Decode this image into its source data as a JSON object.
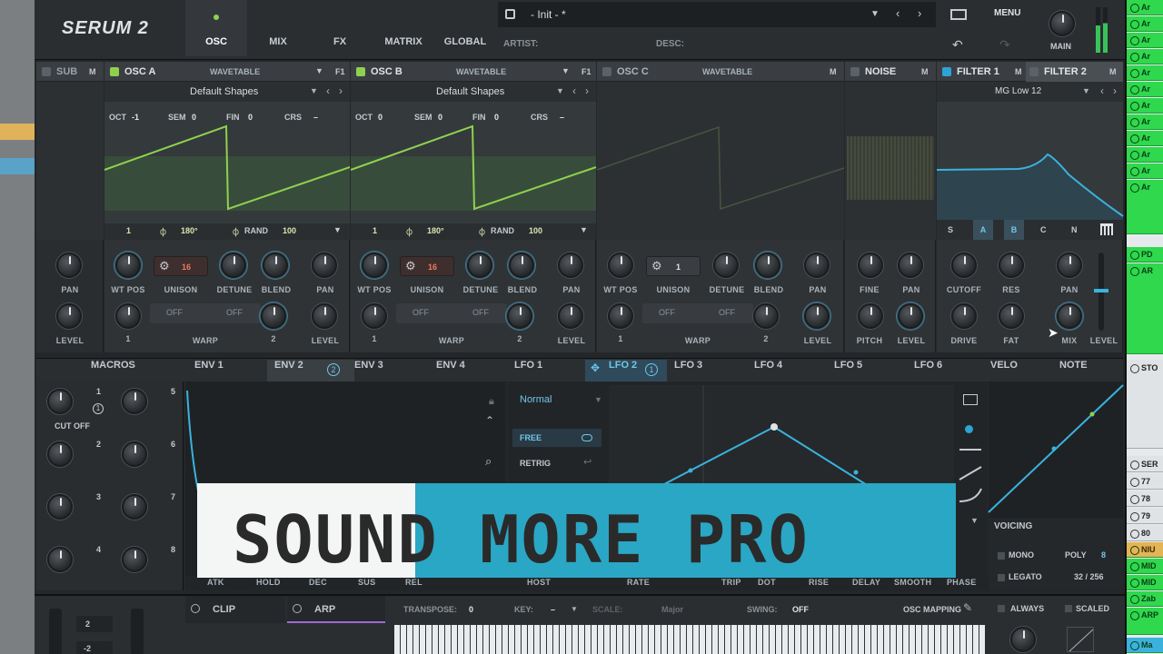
{
  "app": {
    "logo": "SERUM 2",
    "preset": "- Init - *",
    "artist_label": "ARTIST:",
    "desc_label": "DESC:",
    "menu_label": "MENU",
    "main_label": "MAIN"
  },
  "top_tabs": [
    "OSC",
    "MIX",
    "FX",
    "MATRIX",
    "GLOBAL"
  ],
  "modules": {
    "sub": {
      "title": "SUB",
      "m": "M"
    },
    "osc_a": {
      "title": "OSC A",
      "type": "WAVETABLE",
      "m": "M",
      "f": "F1",
      "table": "Default Shapes",
      "oct_l": "OCT",
      "oct": "-1",
      "sem_l": "SEM",
      "sem": "0",
      "fin_l": "FIN",
      "fin": "0",
      "crs_l": "CRS",
      "crs": "–",
      "pos": "1",
      "phase": "180°",
      "rand_l": "RAND",
      "rand": "100",
      "unison": "16"
    },
    "osc_b": {
      "title": "OSC B",
      "type": "WAVETABLE",
      "m": "M",
      "f": "F1",
      "table": "Default Shapes",
      "oct_l": "OCT",
      "oct": "0",
      "sem_l": "SEM",
      "sem": "0",
      "fin_l": "FIN",
      "fin": "0",
      "crs_l": "CRS",
      "crs": "–",
      "pos": "1",
      "phase": "180°",
      "rand_l": "RAND",
      "rand": "100",
      "unison": "16"
    },
    "osc_c": {
      "title": "OSC C",
      "type": "WAVETABLE",
      "m": "M",
      "unison": "1"
    },
    "noise": {
      "title": "NOISE",
      "m": "M"
    },
    "filter1": {
      "title": "FILTER 1",
      "m": "M",
      "type": "MG Low 12",
      "routes": [
        "S",
        "A",
        "B",
        "C",
        "N"
      ]
    },
    "filter2": {
      "title": "FILTER 2",
      "m": "M"
    }
  },
  "knob_labels": {
    "pan": "PAN",
    "level": "LEVEL",
    "wt_pos": "WT POS",
    "unison": "UNISON",
    "detune": "DETUNE",
    "blend": "BLEND",
    "warp": "WARP",
    "off": "OFF",
    "one": "1",
    "two": "2",
    "fine": "FINE",
    "pitch": "PITCH",
    "cutoff": "CUTOFF",
    "res": "RES",
    "drive": "DRIVE",
    "fat": "FAT",
    "mix": "MIX"
  },
  "mod_tabs": [
    "MACROS",
    "ENV 1",
    "ENV 2",
    "ENV 3",
    "ENV 4",
    "LFO 1",
    "LFO 2",
    "LFO 3",
    "LFO 4",
    "LFO 5",
    "LFO 6",
    "VELO",
    "NOTE"
  ],
  "env2_badge": "2",
  "lfo2_badge": "1",
  "macros": {
    "numbers": [
      "1",
      "2",
      "3",
      "4",
      "5",
      "6",
      "7",
      "8"
    ],
    "m1_badge": "1",
    "m1_label": "CUT OFF"
  },
  "lfo": {
    "mode": "Normal",
    "free": "FREE",
    "retrig": "RETRIG",
    "bottom_labels": [
      "HOST",
      "RATE",
      "TRIP",
      "DOT",
      "RISE",
      "DELAY",
      "SMOOTH",
      "PHASE"
    ],
    "env_labels": [
      "ATK",
      "HOLD",
      "DEC",
      "SUS",
      "REL"
    ]
  },
  "voicing": {
    "title": "VOICING",
    "mono": "MONO",
    "poly": "POLY",
    "poly_val": "8",
    "legato": "LEGATO",
    "legato_val": "32 / 256"
  },
  "bottom": {
    "oct_a": "2",
    "oct_b": "-2",
    "clip": "CLIP",
    "arp": "ARP",
    "transpose_l": "TRANSPOSE:",
    "transpose": "0",
    "key_l": "KEY:",
    "key": "–",
    "scale_l": "SCALE:",
    "scale": "Major",
    "swing_l": "SWING:",
    "swing": "OFF",
    "osc_mapping": "OSC MAPPING",
    "always": "ALWAYS",
    "scaled": "SCALED"
  },
  "overlay": {
    "text": "SOUND MORE PRO"
  },
  "sidebar": {
    "green_items": [
      "Ar",
      "Ar",
      "Ar",
      "Ar",
      "Ar",
      "Ar",
      "Ar",
      "Ar",
      "Ar",
      "Ar",
      "Ar",
      "Ar"
    ],
    "items2": [
      "PD",
      "AR"
    ],
    "white_items": [
      "STO"
    ],
    "lower": [
      "SER",
      "77",
      "78",
      "79",
      "80",
      "NIU",
      "MID",
      "MID",
      "Zab",
      "ARP",
      "Ma"
    ]
  },
  "colors": {
    "accent_green": "#8fd14f",
    "accent_blue": "#2ea3d6",
    "overlay_teal": "#2aa7c4",
    "daw_green": "#2fd84d"
  }
}
